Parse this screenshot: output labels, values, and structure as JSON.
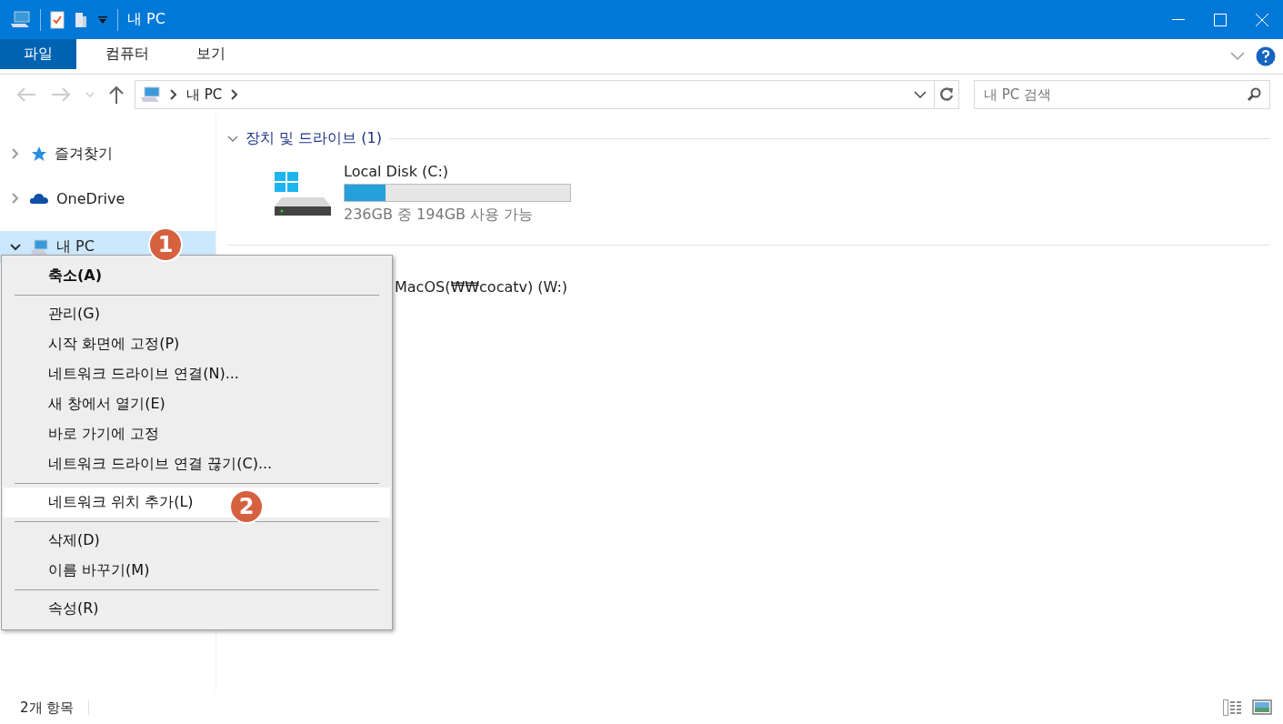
{
  "window": {
    "title": "내 PC"
  },
  "ribbon_tabs": [
    {
      "label": "파일",
      "selected": true
    },
    {
      "label": "컴퓨터",
      "selected": false
    },
    {
      "label": "보기",
      "selected": false
    }
  ],
  "address": {
    "path": [
      "내 PC"
    ]
  },
  "search": {
    "placeholder": "내 PC 검색"
  },
  "sidebar": {
    "items": [
      {
        "label": "즐겨찾기",
        "kind": "star",
        "expanded": false,
        "selected": false
      },
      {
        "label": "OneDrive",
        "kind": "cloud",
        "expanded": false,
        "selected": false
      },
      {
        "label": "내 PC",
        "kind": "pc",
        "expanded": true,
        "selected": true
      }
    ]
  },
  "sections": [
    {
      "title": "장치 및 드라이브",
      "count": "(1)",
      "drives": [
        {
          "name": "Local Disk (C:)",
          "level": 0.18,
          "free": "236GB 중 194GB 사용 가능"
        }
      ]
    },
    {
      "drives": [
        {
          "name": "MacOS(₩₩cocatv) (W:)"
        }
      ]
    }
  ],
  "context_menu": {
    "groups": [
      [
        {
          "label": "축소(A)",
          "default": true,
          "selected": false
        }
      ],
      [
        {
          "label": "관리(G)",
          "default": false,
          "selected": false
        },
        {
          "label": "시작 화면에 고정(P)",
          "default": false,
          "selected": false
        },
        {
          "label": "네트워크 드라이브 연결(N)...",
          "default": false,
          "selected": false
        },
        {
          "label": "새 창에서 열기(E)",
          "default": false,
          "selected": false
        },
        {
          "label": "바로 가기에 고정",
          "default": false,
          "selected": false
        },
        {
          "label": "네트워크 드라이브 연결 끊기(C)...",
          "default": false,
          "selected": false
        }
      ],
      [
        {
          "label": "네트워크 위치 추가(L)",
          "default": false,
          "selected": true
        }
      ],
      [
        {
          "label": "삭제(D)",
          "default": false,
          "selected": false
        },
        {
          "label": "이름 바꾸기(M)",
          "default": false,
          "selected": false
        }
      ],
      [
        {
          "label": "속성(R)",
          "default": false,
          "selected": false
        }
      ]
    ]
  },
  "callouts": [
    "1",
    "2"
  ],
  "status_bar": {
    "count": "2개 항목"
  }
}
